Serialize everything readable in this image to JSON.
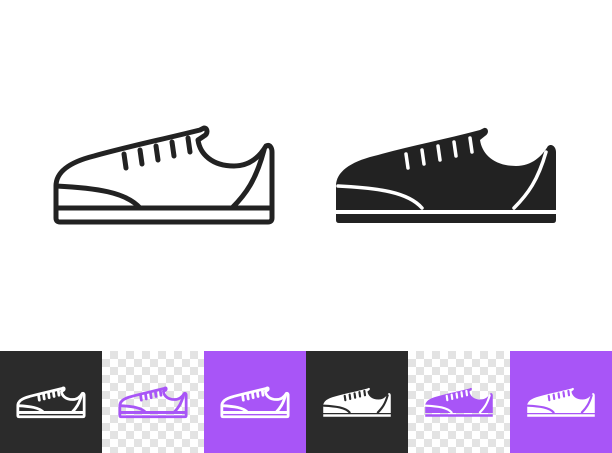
{
  "icons": {
    "outline_variant": "sneaker-outline-icon",
    "solid_variant": "sneaker-solid-icon"
  },
  "colors": {
    "ink": "#222222",
    "dark_tile": "#2b2b2b",
    "purple": "#a855f7",
    "white": "#ffffff"
  },
  "tiles": [
    {
      "name": "tile-dark-outline",
      "background": "dark",
      "icon": "sneaker-outline-icon",
      "icon_color": "#ffffff"
    },
    {
      "name": "tile-checker-outline",
      "background": "checker",
      "icon": "sneaker-outline-icon",
      "icon_color": "#a855f7"
    },
    {
      "name": "tile-purple-outline",
      "background": "purple",
      "icon": "sneaker-outline-icon",
      "icon_color": "#ffffff"
    },
    {
      "name": "tile-dark-solid",
      "background": "dark",
      "icon": "sneaker-solid-icon",
      "icon_color": "#ffffff"
    },
    {
      "name": "tile-checker-solid",
      "background": "checker",
      "icon": "sneaker-solid-icon",
      "icon_color": "#a855f7"
    },
    {
      "name": "tile-purple-solid",
      "background": "purple",
      "icon": "sneaker-solid-icon",
      "icon_color": "#ffffff"
    }
  ]
}
